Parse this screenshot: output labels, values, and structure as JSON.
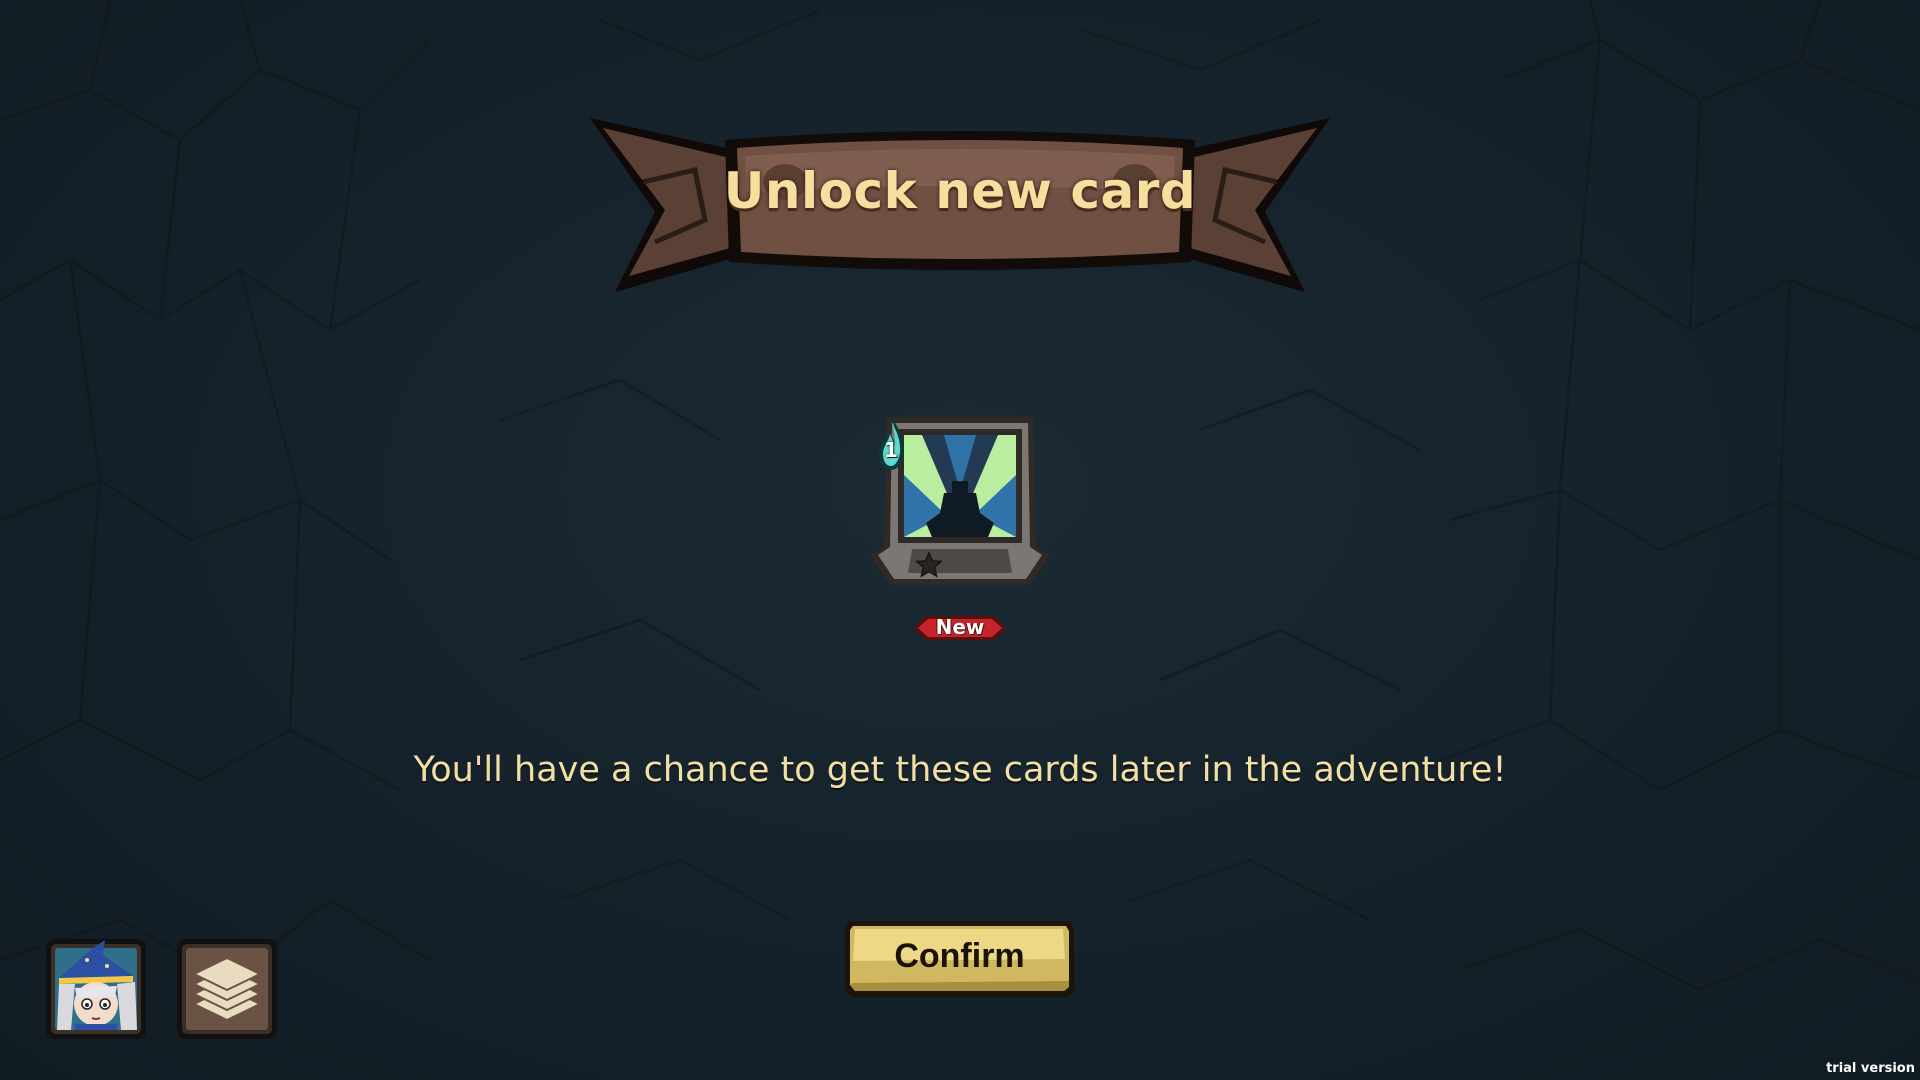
{
  "banner": {
    "title": "Unlock new card"
  },
  "card": {
    "cost": "1",
    "stars_filled": 1,
    "stars_total": 3,
    "art_icon": "lightning-figure-icon",
    "badge": "New"
  },
  "message": "You'll have a chance to get these cards later in the adventure!",
  "confirm_button": {
    "label": "Confirm"
  },
  "corner_buttons": {
    "hero_icon": "wizard-portrait-icon",
    "deck_icon": "card-stack-icon"
  },
  "watermark": "trial version",
  "colors": {
    "background": "#15212a",
    "banner_wood": "#6a4d3f",
    "title_text": "#f6df9e",
    "message_text": "#f1dfa4",
    "button_gold": "#e6cf74",
    "badge_red": "#c8232b",
    "cost_gem": "#5fd8cf",
    "star_gold": "#f5c33b"
  }
}
